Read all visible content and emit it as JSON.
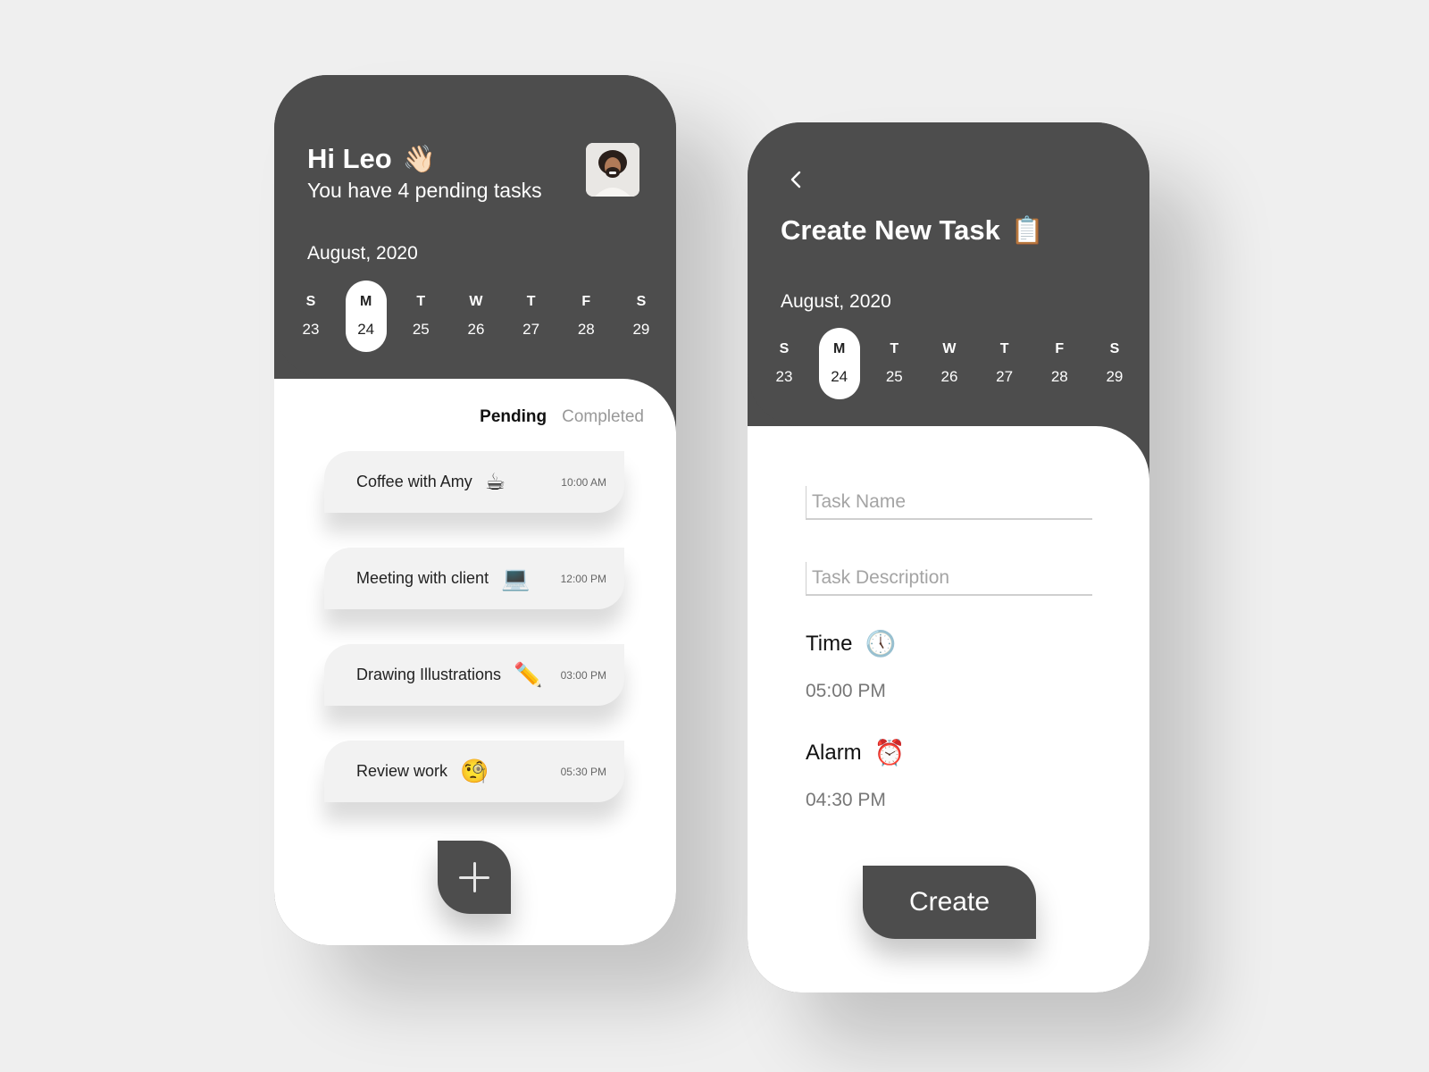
{
  "home": {
    "greeting": "Hi Leo",
    "greeting_emoji": "👋🏻",
    "subtitle": "You have 4 pending tasks",
    "avatar_alt": "profile-photo",
    "month": "August, 2020",
    "week": [
      {
        "name": "S",
        "date": "23",
        "active": false
      },
      {
        "name": "M",
        "date": "24",
        "active": true
      },
      {
        "name": "T",
        "date": "25",
        "active": false
      },
      {
        "name": "W",
        "date": "26",
        "active": false
      },
      {
        "name": "T",
        "date": "27",
        "active": false
      },
      {
        "name": "F",
        "date": "28",
        "active": false
      },
      {
        "name": "S",
        "date": "29",
        "active": false
      }
    ],
    "tabs": {
      "pending": "Pending",
      "completed": "Completed",
      "selected": "Pending"
    },
    "tasks": [
      {
        "name": "Coffee with Amy",
        "emoji": "☕",
        "time": "10:00 AM"
      },
      {
        "name": "Meeting with client",
        "emoji": "💻",
        "time": "12:00 PM"
      },
      {
        "name": "Drawing Illustrations",
        "emoji": "✏️",
        "time": "03:00 PM"
      },
      {
        "name": "Review work",
        "emoji": "🧐",
        "time": "05:30 PM"
      }
    ],
    "fab_icon": "plus-icon"
  },
  "create": {
    "back_icon": "chevron-left-icon",
    "title": "Create New Task",
    "title_emoji": "📋",
    "month": "August, 2020",
    "week": [
      {
        "name": "S",
        "date": "23",
        "active": false
      },
      {
        "name": "M",
        "date": "24",
        "active": true
      },
      {
        "name": "T",
        "date": "25",
        "active": false
      },
      {
        "name": "W",
        "date": "26",
        "active": false
      },
      {
        "name": "T",
        "date": "27",
        "active": false
      },
      {
        "name": "F",
        "date": "28",
        "active": false
      },
      {
        "name": "S",
        "date": "29",
        "active": false
      }
    ],
    "task_name_placeholder": "Task Name",
    "task_name_value": "",
    "task_description_placeholder": "Task Description",
    "task_description_value": "",
    "time_label": "Time",
    "time_emoji": "🕔",
    "time_value": "05:00 PM",
    "alarm_label": "Alarm",
    "alarm_emoji": "⏰",
    "alarm_value": "04:30 PM",
    "create_label": "Create"
  },
  "colors": {
    "background": "#efefef",
    "header": "#4d4d4d",
    "card": "#f2f2f2",
    "muted_text": "#999999"
  }
}
